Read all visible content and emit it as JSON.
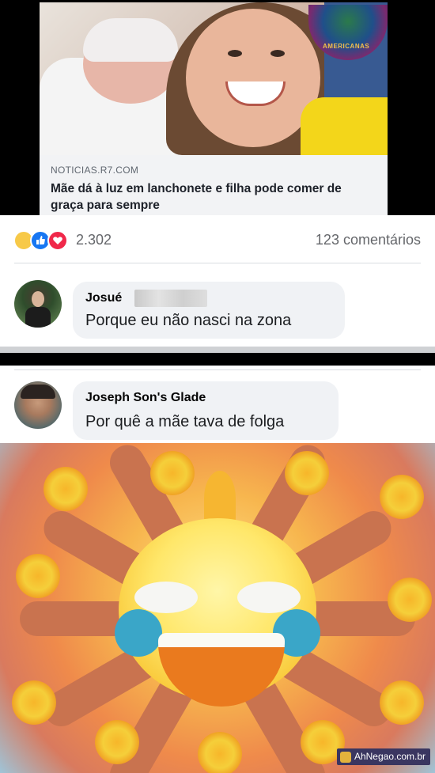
{
  "link_card": {
    "domain": "NOTICIAS.R7.COM",
    "title": "Mãe dá à luz em lanchonete e filha pode comer de graça para sempre"
  },
  "reactions": {
    "icons": [
      "haha-icon",
      "like-icon",
      "love-icon"
    ],
    "count": "2.302",
    "comments": "123 comentários"
  },
  "comments": [
    {
      "name": "Josué",
      "name_blurred": true,
      "text": "Porque eu não nasci na zona"
    },
    {
      "name": "Joseph Son's Glade",
      "text": "Por quê a mãe tava de folga"
    }
  ],
  "watermark": {
    "text": "AhNegao.com.br"
  },
  "colors": {
    "like": "#1877f2",
    "love": "#f0284a",
    "haha": "#f7c948",
    "bubble": "#f0f2f5",
    "secondary_text": "#65676b"
  }
}
